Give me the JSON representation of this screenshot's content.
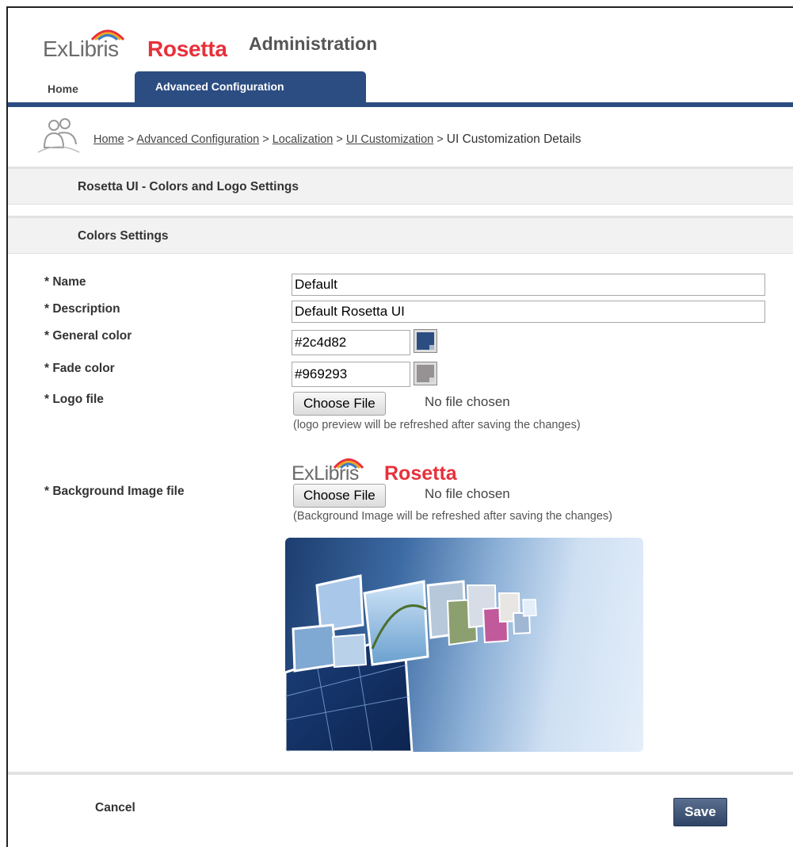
{
  "app": {
    "logo_part1": "ExLibris",
    "logo_part2": "Rosetta",
    "title": "Administration"
  },
  "tabs": [
    {
      "label": "Home"
    },
    {
      "label": "Advanced Configuration",
      "active": true
    }
  ],
  "breadcrumb": {
    "items": [
      "Home",
      "Advanced Configuration",
      "Localization",
      "UI Customization"
    ],
    "separator": ">",
    "current": "UI Customization Details"
  },
  "sections": {
    "page": "Rosetta UI - Colors and Logo Settings",
    "colors": "Colors Settings"
  },
  "form": {
    "name": {
      "label": "* Name",
      "value": "Default"
    },
    "description": {
      "label": "* Description",
      "value": "Default Rosetta UI"
    },
    "general_color": {
      "label": "* General color",
      "value": "#2c4d82"
    },
    "fade_color": {
      "label": "* Fade color",
      "value": "#969293"
    },
    "logo_file": {
      "label": "* Logo file",
      "button": "Choose File",
      "status": "No file chosen",
      "hint": "(logo preview will be refreshed after saving the changes)"
    },
    "background_file": {
      "label": "* Background Image file",
      "button": "Choose File",
      "status": "No file chosen",
      "hint": "(Background Image will be refreshed after saving the changes)"
    }
  },
  "actions": {
    "cancel": "Cancel",
    "save": "Save"
  },
  "colors": {
    "brand_blue": "#2c4d82",
    "brand_red": "#e8303b",
    "fade_gray": "#969293"
  }
}
